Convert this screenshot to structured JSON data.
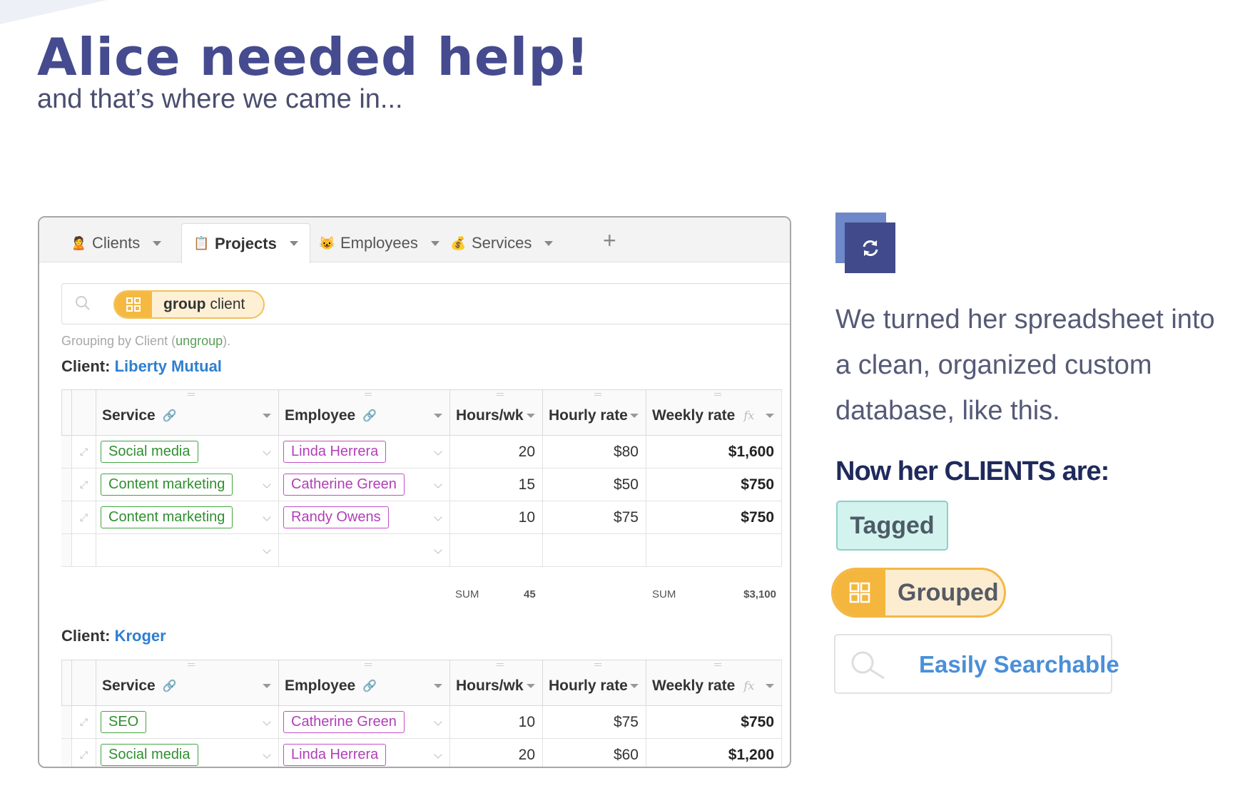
{
  "heading": {
    "title": "Alice needed help!",
    "subtitle": "and that’s where we came in..."
  },
  "app": {
    "tabs": [
      {
        "label": "Clients",
        "icon": "🙎"
      },
      {
        "label": "Projects",
        "icon": "📋"
      },
      {
        "label": "Employees",
        "icon": "😺"
      },
      {
        "label": "Services",
        "icon": "💰"
      }
    ],
    "add_tab": "+",
    "search_chip": {
      "keyword": "group",
      "value": "client"
    },
    "grouping_note": {
      "prefix": "Grouping by Client (",
      "link": "ungroup",
      "suffix": ")."
    },
    "columns": [
      "Service",
      "Employee",
      "Hours/wk",
      "Hourly rate",
      "Weekly rate"
    ],
    "groups": [
      {
        "label": "Client:",
        "client": "Liberty Mutual",
        "rows": [
          {
            "service": "Social media",
            "employee": "Linda Herrera",
            "hours": "20",
            "rate": "$80",
            "weekly": "$1,600"
          },
          {
            "service": "Content marketing",
            "employee": "Catherine Green",
            "hours": "15",
            "rate": "$50",
            "weekly": "$750"
          },
          {
            "service": "Content marketing",
            "employee": "Randy Owens",
            "hours": "10",
            "rate": "$75",
            "weekly": "$750"
          }
        ],
        "sum_label": "SUM",
        "sum_hours": "45",
        "sum_weekly": "$3,100"
      },
      {
        "label": "Client:",
        "client": "Kroger",
        "rows": [
          {
            "service": "SEO",
            "employee": "Catherine Green",
            "hours": "10",
            "rate": "$75",
            "weekly": "$750"
          },
          {
            "service": "Social media",
            "employee": "Linda Herrera",
            "hours": "20",
            "rate": "$60",
            "weekly": "$1,200"
          }
        ]
      }
    ]
  },
  "side": {
    "description": "We turned her spreadsheet into a clean, organized custom database, like this.",
    "now_heading": "Now her CLIENTS are:",
    "features": {
      "tagged": "Tagged",
      "grouped": "Grouped",
      "searchable": "Easily Searchable"
    }
  },
  "colors": {
    "title": "#454b8e",
    "accent_blue": "#2e7fd0",
    "pill_orange": "#f5b941",
    "tag_green": "#42a342",
    "tag_purple": "#c04fc6",
    "tagged_bg": "#d3f3ef"
  }
}
